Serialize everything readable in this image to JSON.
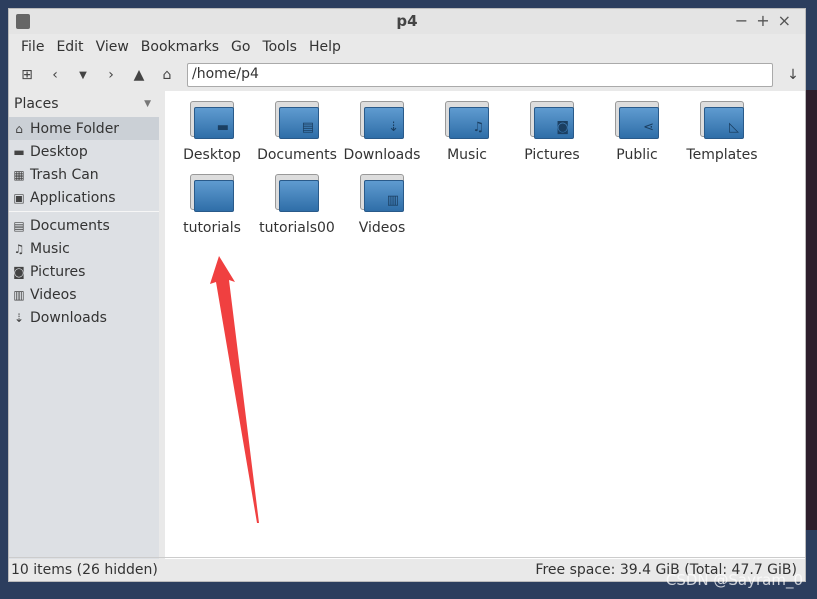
{
  "window": {
    "title": "p4",
    "controls": [
      "−",
      "+",
      "×"
    ]
  },
  "menu": [
    "File",
    "Edit",
    "View",
    "Bookmarks",
    "Go",
    "Tools",
    "Help"
  ],
  "toolbar": {
    "path": "/home/p4"
  },
  "sidebar": {
    "header": "Places",
    "items": [
      {
        "label": "Home Folder",
        "icon": "home-icon",
        "glyph": "⌂",
        "selected": true
      },
      {
        "label": "Desktop",
        "icon": "desktop-icon",
        "glyph": "▬"
      },
      {
        "label": "Trash Can",
        "icon": "trash-icon",
        "glyph": "▦"
      },
      {
        "label": "Applications",
        "icon": "applications-icon",
        "glyph": "▣"
      }
    ],
    "bookmarks": [
      {
        "label": "Documents",
        "icon": "document-icon",
        "glyph": "▤"
      },
      {
        "label": "Music",
        "icon": "music-icon",
        "glyph": "♫"
      },
      {
        "label": "Pictures",
        "icon": "camera-icon",
        "glyph": "◙"
      },
      {
        "label": "Videos",
        "icon": "film-icon",
        "glyph": "▥"
      },
      {
        "label": "Downloads",
        "icon": "download-icon",
        "glyph": "⇣"
      }
    ]
  },
  "files": [
    {
      "name": "Desktop",
      "glyph": "▬"
    },
    {
      "name": "Documents",
      "glyph": "▤"
    },
    {
      "name": "Downloads",
      "glyph": "⇣"
    },
    {
      "name": "Music",
      "glyph": "♫"
    },
    {
      "name": "Pictures",
      "glyph": "◙"
    },
    {
      "name": "Public",
      "glyph": "⋖"
    },
    {
      "name": "Templates",
      "glyph": "◺"
    },
    {
      "name": "tutorials",
      "glyph": ""
    },
    {
      "name": "tutorials00",
      "glyph": ""
    },
    {
      "name": "Videos",
      "glyph": "▥"
    }
  ],
  "status": {
    "items": "10 items (26 hidden)",
    "free": "Free space: 39.4 GiB (Total: 47.7 GiB)"
  },
  "watermark": "CSDN @Sayram_0",
  "annotation_color": "#f04040"
}
